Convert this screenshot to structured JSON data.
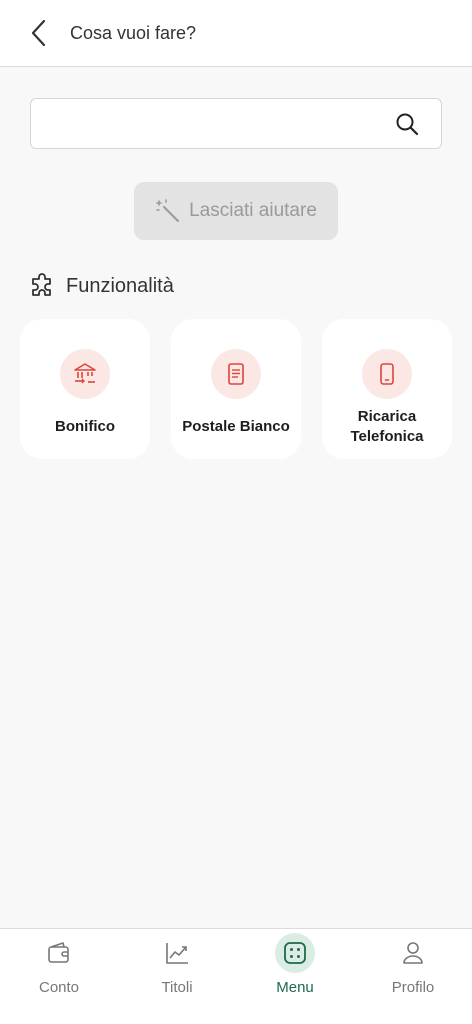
{
  "header": {
    "title": "Cosa vuoi fare?"
  },
  "search": {
    "value": "",
    "placeholder": ""
  },
  "help_button": {
    "label": "Lasciati aiutare"
  },
  "section": {
    "title": "Funzionalità"
  },
  "tiles": [
    {
      "label": "Bonifico",
      "icon": "bank-transfer-icon"
    },
    {
      "label": "Postale Bianco",
      "icon": "document-icon"
    },
    {
      "label": "Ricarica\nTelefonica",
      "icon": "smartphone-icon"
    }
  ],
  "nav": [
    {
      "label": "Conto",
      "icon": "wallet-icon",
      "active": false
    },
    {
      "label": "Titoli",
      "icon": "chart-line-icon",
      "active": false
    },
    {
      "label": "Menu",
      "icon": "menu-grid-icon",
      "active": true
    },
    {
      "label": "Profilo",
      "icon": "user-icon",
      "active": false
    }
  ],
  "colors": {
    "accent_red": "#e0443a",
    "accent_green": "#1d6b4b"
  }
}
